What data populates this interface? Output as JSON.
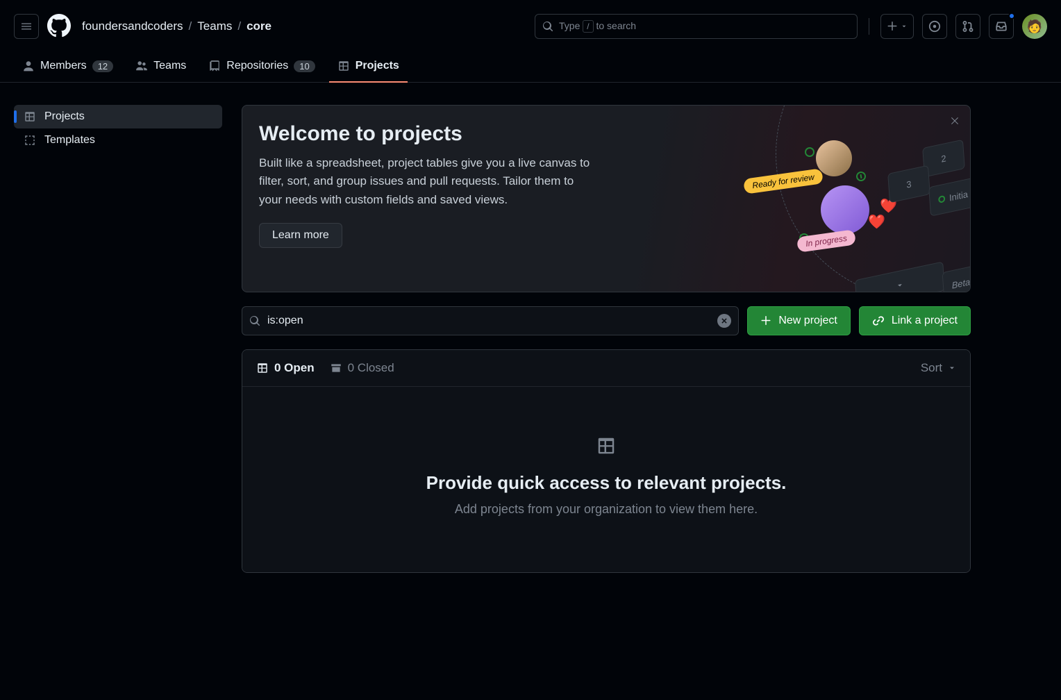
{
  "header": {
    "breadcrumb": [
      "foundersandcoders",
      "Teams",
      "core"
    ],
    "search_prefix": "Type ",
    "search_key": "/",
    "search_suffix": " to search"
  },
  "tabs": {
    "members": {
      "label": "Members",
      "count": "12"
    },
    "teams": {
      "label": "Teams"
    },
    "repos": {
      "label": "Repositories",
      "count": "10"
    },
    "projects": {
      "label": "Projects"
    }
  },
  "sidenav": {
    "projects": "Projects",
    "templates": "Templates"
  },
  "welcome": {
    "title": "Welcome to projects",
    "desc": "Built like a spreadsheet, project tables give you a live canvas to filter, sort, and group issues and pull requests. Tailor them to your needs with custom fields and saved views.",
    "learn": "Learn more",
    "decor_pill1": "Ready for review",
    "decor_pill2": "In progress",
    "decor_t1": "2",
    "decor_t2": "3",
    "decor_t3": "Initia",
    "decor_t5": "Beta"
  },
  "filter": {
    "value": "is:open"
  },
  "buttons": {
    "new_project": "New project",
    "link_project": "Link a project"
  },
  "toolbar": {
    "open": "0 Open",
    "closed": "0 Closed",
    "sort": "Sort"
  },
  "blankslate": {
    "title": "Provide quick access to relevant projects.",
    "sub": "Add projects from your organization to view them here."
  }
}
